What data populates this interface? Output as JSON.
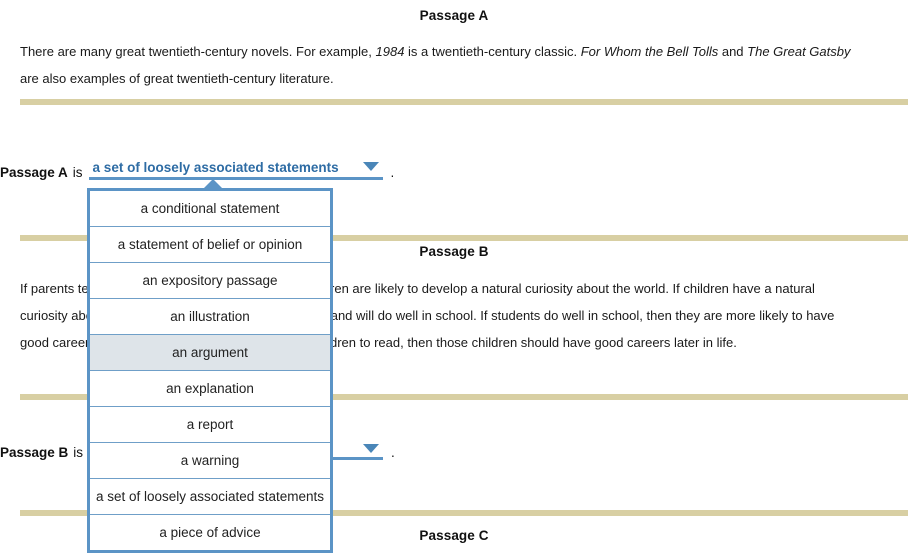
{
  "passages": [
    {
      "heading": "Passage A",
      "body_parts": [
        {
          "text": "There are many great twentieth-century novels. For example, ",
          "italic": false
        },
        {
          "text": "1984",
          "italic": true
        },
        {
          "text": " is a twentieth-century classic. ",
          "italic": false
        },
        {
          "text": "For Whom the Bell Tolls",
          "italic": true
        },
        {
          "text": " and ",
          "italic": false
        },
        {
          "text": "The Great Gatsby",
          "italic": true
        },
        {
          "text": " are also examples of great twentieth-century literature.",
          "italic": false
        }
      ]
    },
    {
      "heading": "Passage B",
      "body_parts": [
        {
          "text": "If parents teach their children to read, then those children are likely to develop a natural curiosity about the world. If children have a natural curiosity about the world, then they will enjoy learning and will do well in school. If students do well in school, then they are more likely to have good careers later in life. So, if parents teach their children to read, then those children should have good careers later in life.",
          "italic": false
        }
      ]
    },
    {
      "heading": "Passage C",
      "body_parts": []
    }
  ],
  "questions": [
    {
      "label": "Passage A",
      "is_word": "is",
      "selected_value": "a set of loosely associated statements",
      "period": ".",
      "caret_icon": "chevron-down-icon",
      "open": true
    },
    {
      "label": "Passage B",
      "is_word": "is",
      "selected_value": "",
      "period": ".",
      "caret_icon": "chevron-down-icon",
      "open": false
    }
  ],
  "options": [
    "a conditional statement",
    "a statement of belief or opinion",
    "an expository passage",
    "an illustration",
    "an argument",
    "an explanation",
    "a report",
    "a warning",
    "a set of loosely associated statements",
    "a piece of advice"
  ],
  "highlighted_option_index": 4,
  "colors": {
    "rule": "#d8cfa3",
    "dropdown_border": "#5b94c6",
    "dropdown_text": "#2e6ca4",
    "caret": "#4a86b8",
    "option_highlight": "#dee4e9",
    "option_divider": "#6f9fc8"
  }
}
